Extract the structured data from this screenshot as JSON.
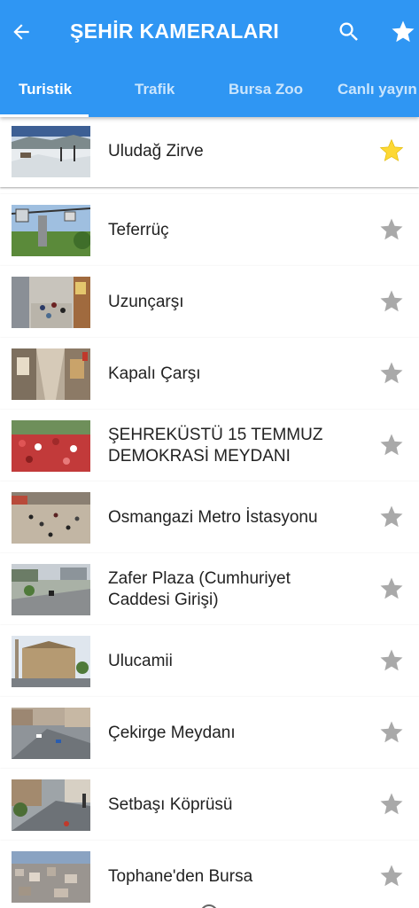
{
  "appbar": {
    "title": "ŞEHİR KAMERALARI",
    "background": "#2f96f3",
    "icons": {
      "back": "arrow-left-icon",
      "search": "search-icon",
      "favorites": "star-icon"
    }
  },
  "tabs": [
    {
      "label": "Turistik",
      "active": true
    },
    {
      "label": "Trafik",
      "active": false
    },
    {
      "label": "Bursa Zoo",
      "active": false
    },
    {
      "label": "Canlı yayın",
      "active": false
    }
  ],
  "cameras": [
    {
      "lines": [
        "Uludağ Zirve"
      ],
      "favorite": true
    },
    {
      "lines": [
        "Teferrüç"
      ],
      "favorite": false
    },
    {
      "lines": [
        "Uzunçarşı"
      ],
      "favorite": false
    },
    {
      "lines": [
        "Kapalı Çarşı"
      ],
      "favorite": false
    },
    {
      "lines": [
        "ŞEHREKÜSTÜ 15 TEMMUZ",
        "DEMOKRASİ MEYDANI"
      ],
      "favorite": false
    },
    {
      "lines": [
        "Osmangazi Metro İstasyonu"
      ],
      "favorite": false
    },
    {
      "lines": [
        "Zafer Plaza (Cumhuriyet",
        "Caddesi Girişi)"
      ],
      "favorite": false
    },
    {
      "lines": [
        "Ulucamii"
      ],
      "favorite": false
    },
    {
      "lines": [
        "Çekirge Meydanı"
      ],
      "favorite": false
    },
    {
      "lines": [
        "Setbaşı Köprüsü"
      ],
      "favorite": false
    },
    {
      "lines": [
        "Tophane'den Bursa"
      ],
      "favorite": false
    }
  ],
  "colors": {
    "star_active": "#fdd835",
    "star_inactive": "#a9a9a9"
  }
}
